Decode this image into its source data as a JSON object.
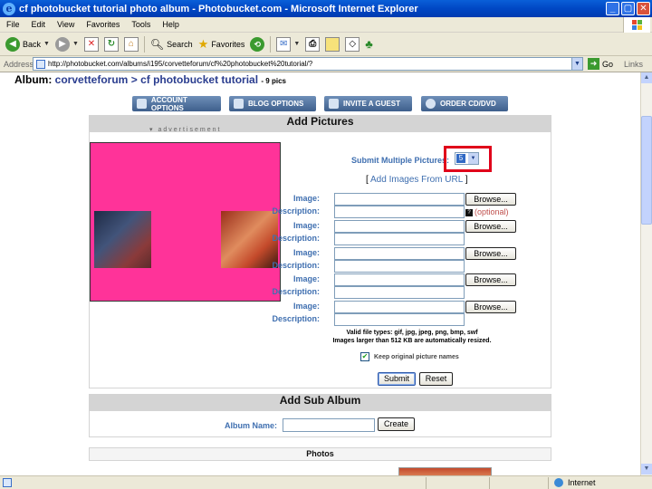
{
  "window": {
    "title": "cf photobucket tutorial photo album - Photobucket.com - Microsoft Internet Explorer",
    "controls": [
      "_",
      "▢",
      "✕"
    ]
  },
  "menu": [
    "File",
    "Edit",
    "View",
    "Favorites",
    "Tools",
    "Help"
  ],
  "toolbar": {
    "back": "Back",
    "search": "Search",
    "favorites": "Favorites"
  },
  "address": {
    "label": "Address",
    "url": "http://photobucket.com/albums/i195/corvetteforum/cf%20photobucket%20tutorial/?",
    "go": "Go",
    "links": "Links"
  },
  "page": {
    "album_prefix": "Album:",
    "crumb_root": "corvetteforum",
    "crumb_sep": ">",
    "crumb_album": "cf photobucket tutorial",
    "pic_count": "- 9 pics",
    "options": [
      "ACCOUNT OPTIONS",
      "BLOG OPTIONS",
      "INVITE A GUEST",
      "ORDER CD/DVD"
    ],
    "add_pictures": {
      "heading": "Add Pictures",
      "advertisement": "advertisement",
      "submit_multiple_label": "Submit Multiple Pictures:",
      "submit_multiple_value": "5",
      "add_from_url_open": "[",
      "add_from_url": "Add Images From URL",
      "add_from_url_close": "]",
      "image_label": "Image:",
      "description_label": "Description:",
      "browse": "Browse...",
      "optional": "(optional)",
      "optional_help": "?",
      "valid_types_line1": "Valid file types: gif, jpg, jpeg, png, bmp, swf",
      "valid_types_line2": "Images larger than 512 KB are automatically resized.",
      "keep_names": "Keep original picture names",
      "keep_names_checked": true,
      "submit": "Submit",
      "reset": "Reset"
    },
    "sub_album": {
      "heading": "Add Sub Album",
      "album_name_label": "Album Name:",
      "create": "Create"
    },
    "photos_heading": "Photos"
  },
  "status": {
    "zone": "Internet"
  },
  "colors": {
    "accent_blue": "#3f6fb0",
    "highlight_red": "#e0001a",
    "ad_pink": "#ff3399"
  }
}
